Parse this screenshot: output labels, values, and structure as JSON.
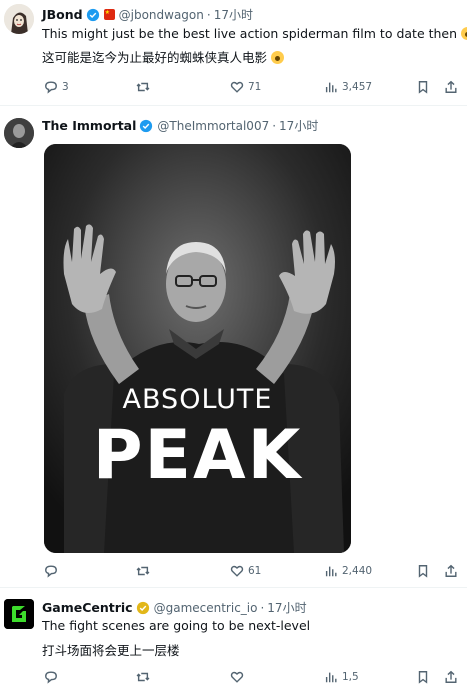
{
  "tweets": [
    {
      "name": "JBond",
      "handle": "@jbondwagon",
      "separator": "·",
      "time": "17小时",
      "lines": [
        "This might just be the best live action spiderman film to date then",
        "这可能是迄今为止最好的蜘蛛侠真人电影"
      ],
      "emoji": "astonished-face",
      "replies": "3",
      "retweets": "",
      "likes": "71",
      "views": "3,457"
    },
    {
      "name": "The Immortal",
      "handle": "@TheImmortal007",
      "separator": "·",
      "time": "17小时",
      "media": {
        "line1": "ABSOLUTE",
        "line2": "PEAK"
      },
      "replies": "",
      "retweets": "",
      "likes": "61",
      "views": "2,440"
    },
    {
      "name": "GameCentric",
      "handle": "@gamecentric_io",
      "separator": "·",
      "time": "17小时",
      "lines": [
        "The fight scenes are going to be next-level",
        "打斗场面将会更上一层楼"
      ],
      "replies": "",
      "retweets": "",
      "likes": "",
      "views": "1,5"
    }
  ],
  "colors": {
    "verified_blue": "#1d9bf0",
    "verified_gold": "#e2b719",
    "muted": "#536471"
  }
}
